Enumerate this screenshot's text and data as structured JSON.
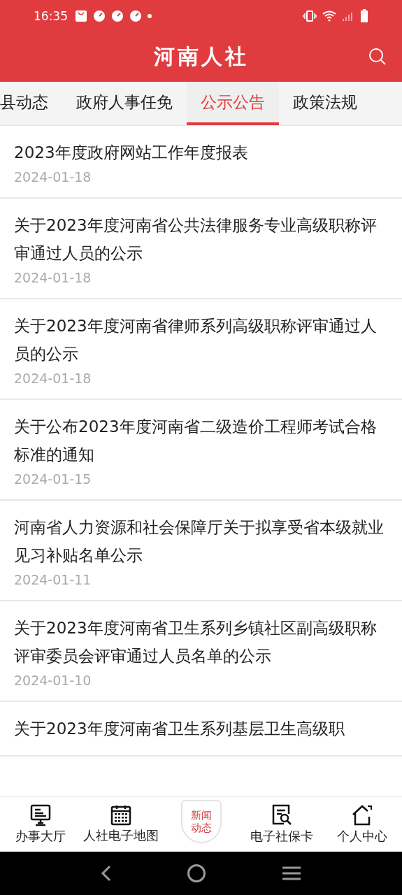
{
  "status_bar": {
    "time": "16:35"
  },
  "header": {
    "title": "河南人社"
  },
  "tabs": [
    {
      "label": "县动态",
      "selected": false
    },
    {
      "label": "政府人事任免",
      "selected": false
    },
    {
      "label": "公示公告",
      "selected": true
    },
    {
      "label": "政策法规",
      "selected": false
    }
  ],
  "articles": [
    {
      "title": "2023年度政府网站工作年度报表",
      "date": "2024-01-18"
    },
    {
      "title": "关于2023年度河南省公共法律服务专业高级职称评审通过人员的公示",
      "date": "2024-01-18"
    },
    {
      "title": "关于2023年度河南省律师系列高级职称评审通过人员的公示",
      "date": "2024-01-18"
    },
    {
      "title": "关于公布2023年度河南省二级造价工程师考试合格标准的通知",
      "date": "2024-01-15"
    },
    {
      "title": "河南省人力资源和社会保障厅关于拟享受省本级就业见习补贴名单公示",
      "date": "2024-01-11"
    },
    {
      "title": "关于2023年度河南省卫生系列乡镇社区副高级职称评审委员会评审通过人员名单的公示",
      "date": "2024-01-10"
    },
    {
      "title": "关于2023年度河南省卫生系列基层卫生高级职"
    }
  ],
  "bottom_nav": [
    {
      "label": "办事大厅",
      "kind": "icon"
    },
    {
      "label": "人社电子地图",
      "kind": "icon"
    },
    {
      "label": "新闻动态",
      "kind": "badge"
    },
    {
      "label": "电子社保卡",
      "kind": "icon"
    },
    {
      "label": "个人中心",
      "kind": "icon"
    }
  ]
}
